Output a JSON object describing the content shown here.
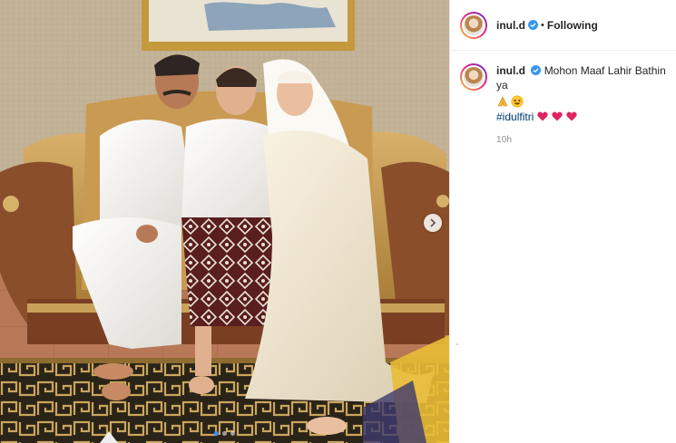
{
  "post": {
    "username": "inul.d",
    "separator": "•",
    "follow_status": "Following",
    "caption_text": "Mohon Maaf Lahir Bathin ya",
    "hashtag": "#idulfitri",
    "timestamp": "10h",
    "emojis": [
      "folded-hands",
      "grinning-squinting-face"
    ],
    "hearts": [
      "red-heart",
      "red-heart",
      "red-heart"
    ]
  },
  "carousel": {
    "slide_count": 3,
    "active_slide": 1
  },
  "colors": {
    "verified_badge": "#3897f0",
    "link": "#00376b",
    "active_dot": "#3a8cff",
    "heart": "#e0245e"
  },
  "icons": {
    "next": "chevron-right-icon",
    "verified": "verified-badge-icon"
  }
}
